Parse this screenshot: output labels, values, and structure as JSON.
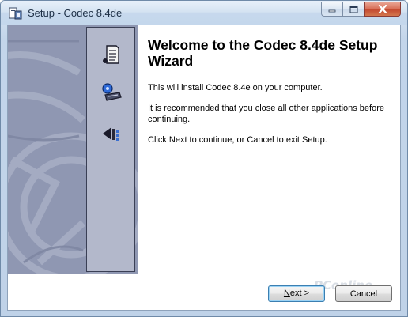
{
  "window": {
    "title": "Setup - Codec 8.4de",
    "app_icon": "setup-app-icon"
  },
  "controls": {
    "minimize": "minimize-icon",
    "maximize": "maximize-icon",
    "close": "close-icon"
  },
  "sidebar": {
    "icons": [
      "document-icon",
      "install-disk-icon",
      "speaker-icon"
    ]
  },
  "main": {
    "heading": "Welcome to the Codec 8.4de Setup Wizard",
    "paragraphs": [
      "This will install Codec 8.4e on your computer.",
      "It is recommended that you close all other applications before continuing.",
      "Click Next to continue, or Cancel to exit Setup."
    ]
  },
  "footer": {
    "watermark": "PConline",
    "next_label": "Next >",
    "next_mnemonic": "N",
    "next_rest": "ext >",
    "cancel_label": "Cancel"
  },
  "colors": {
    "sidebar_bg": "#8f97b2",
    "icon_strip": "#b3b8cb",
    "close_button": "#c44a30",
    "titlebar": "#c6d8ed"
  }
}
